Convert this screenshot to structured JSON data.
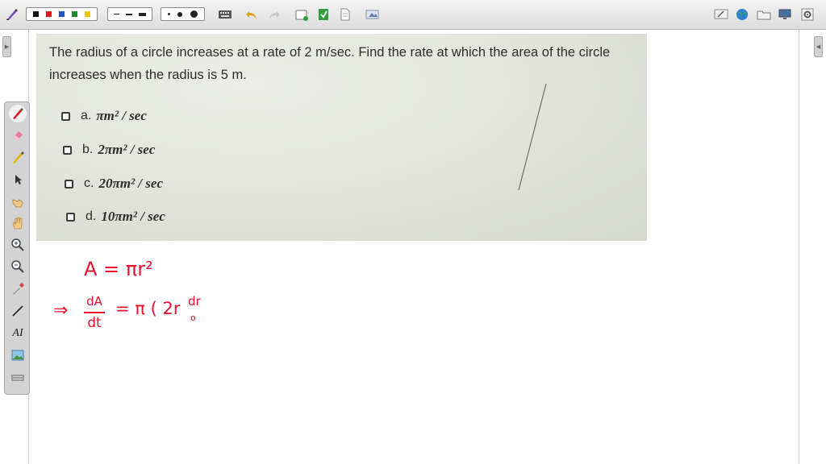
{
  "toolbar": {
    "colors": [
      "#111111",
      "#e0141e",
      "#1f57c4",
      "#1b8a2a",
      "#f2c500"
    ],
    "tools": [
      "pen-tool",
      "color-palette",
      "line-style",
      "dot-size",
      "keyboard",
      "undo",
      "redo",
      "new-page",
      "save",
      "document",
      "screenshot",
      "whiteboard",
      "globe",
      "folder",
      "monitor",
      "settings"
    ]
  },
  "sidebar": {
    "tools": [
      "pen-tool",
      "eraser",
      "highlighter",
      "pointer",
      "hand-pointer",
      "hand",
      "zoom-in",
      "zoom-out",
      "eyedropper",
      "line",
      "text",
      "image",
      "keyboard"
    ],
    "text_tool_label": "AI"
  },
  "question": {
    "text": "The radius of a circle increases at a rate of 2 m/sec. Find the rate at which the area of the circle increases when the radius is 5 m.",
    "options": [
      {
        "label": "a.",
        "value": "πm² / sec"
      },
      {
        "label": "b.",
        "value": "2πm² / sec"
      },
      {
        "label": "c.",
        "value": "20πm² / sec"
      },
      {
        "label": "d.",
        "value": "10πm² / sec"
      }
    ]
  },
  "handwriting": {
    "color": "#e8102e",
    "line1": "A = πr²",
    "line2_arrow": "⇒",
    "line2_num": "dA",
    "line2_den": "dt",
    "line2_rhs": "= π ( 2r",
    "line2_frac_num": "dr",
    "line2_frac_den": "o"
  }
}
